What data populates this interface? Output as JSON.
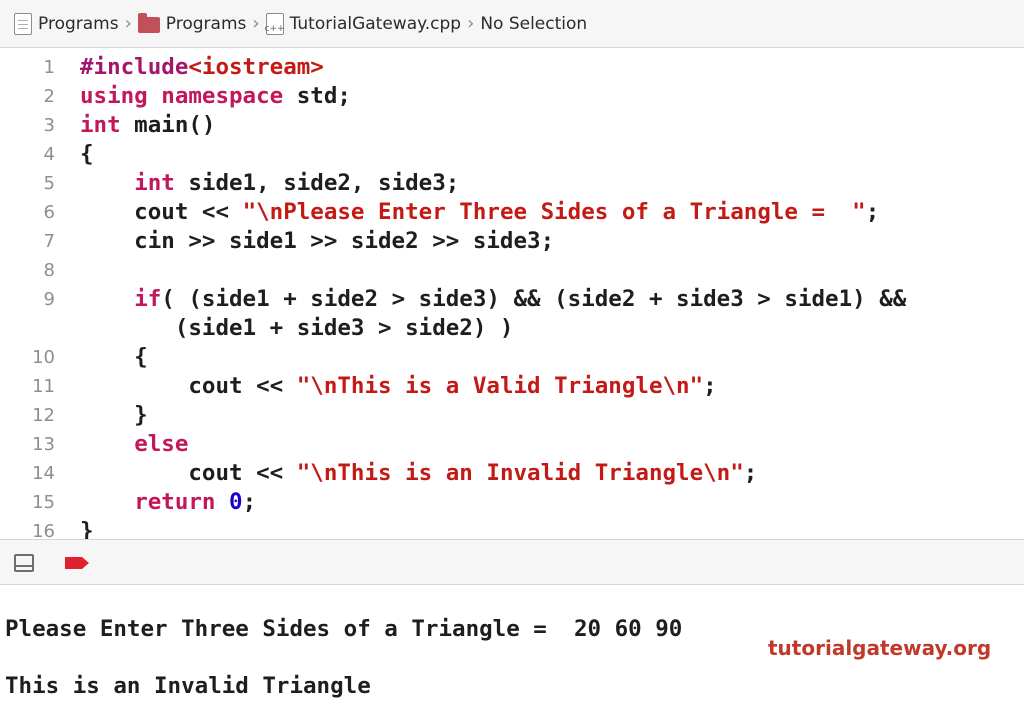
{
  "breadcrumb": {
    "items": [
      {
        "icon": "document-icon",
        "label": "Programs"
      },
      {
        "icon": "folder-icon",
        "label": "Programs"
      },
      {
        "icon": "cpp-file-icon",
        "label": "TutorialGateway.cpp"
      },
      {
        "icon": "",
        "label": "No Selection"
      }
    ]
  },
  "code": {
    "lines": [
      {
        "n": "1",
        "t": "#include<iostream>"
      },
      {
        "n": "2",
        "t": "using namespace std;"
      },
      {
        "n": "3",
        "t": "int main()"
      },
      {
        "n": "4",
        "t": "{"
      },
      {
        "n": "5",
        "t": "    int side1, side2, side3;"
      },
      {
        "n": "6",
        "t": "    cout << \"\\nPlease Enter Three Sides of a Triangle =  \";"
      },
      {
        "n": "7",
        "t": "    cin >> side1 >> side2 >> side3;"
      },
      {
        "n": "8",
        "t": ""
      },
      {
        "n": "9",
        "t": "    if( (side1 + side2 > side3) && (side2 + side3 > side1) &&"
      },
      {
        "n": "",
        "t": "       (side1 + side3 > side2) )"
      },
      {
        "n": "10",
        "t": "    {"
      },
      {
        "n": "11",
        "t": "        cout << \"\\nThis is a Valid Triangle\\n\";"
      },
      {
        "n": "12",
        "t": "    }"
      },
      {
        "n": "13",
        "t": "    else"
      },
      {
        "n": "14",
        "t": "        cout << \"\\nThis is an Invalid Triangle\\n\";"
      },
      {
        "n": "15",
        "t": "    return 0;"
      },
      {
        "n": "16",
        "t": "}"
      }
    ]
  },
  "debug_bar": {
    "panel_icon": "hide-debug-area-icon",
    "breakpoint_icon": "breakpoint-icon"
  },
  "console": {
    "line1": "Please Enter Three Sides of a Triangle =  20 60 90",
    "line2": "This is an Invalid Triangle"
  },
  "watermark": "tutorialgateway.org",
  "colors": {
    "keyword": "#c2185b",
    "string": "#c41a16",
    "number": "#1c00cf",
    "watermark": "#c0392b"
  }
}
